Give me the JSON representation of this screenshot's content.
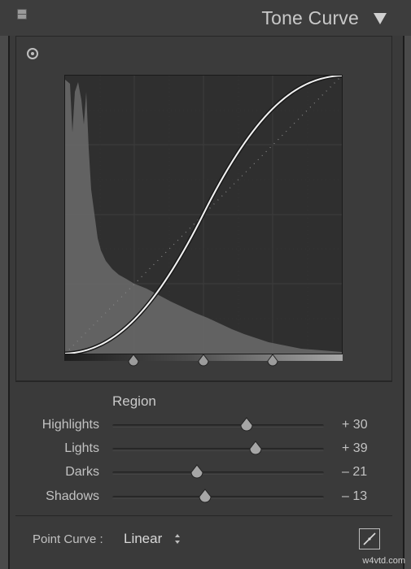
{
  "header": {
    "title": "Tone Curve"
  },
  "icons": {
    "panel_toggle": "panel-toggle-icon",
    "collapse": "collapse-triangle-icon",
    "targeted_adjustment": "target-adjust-icon",
    "edit_point_curve": "edit-point-curve-icon"
  },
  "region": {
    "label": "Region",
    "sliders": [
      {
        "label": "Highlights",
        "value_text": "+ 30",
        "value": 30
      },
      {
        "label": "Lights",
        "value_text": "+ 39",
        "value": 39
      },
      {
        "label": "Darks",
        "value_text": "– 21",
        "value": -21
      },
      {
        "label": "Shadows",
        "value_text": "– 13",
        "value": -13
      }
    ]
  },
  "point_curve": {
    "label": "Point Curve :",
    "value": "Linear"
  },
  "watermark": "w4vtd.com",
  "colors": {
    "panel_bg": "#3a3a3a",
    "curve_line": "#f2f2f2",
    "histogram": "#6b6b6b"
  }
}
